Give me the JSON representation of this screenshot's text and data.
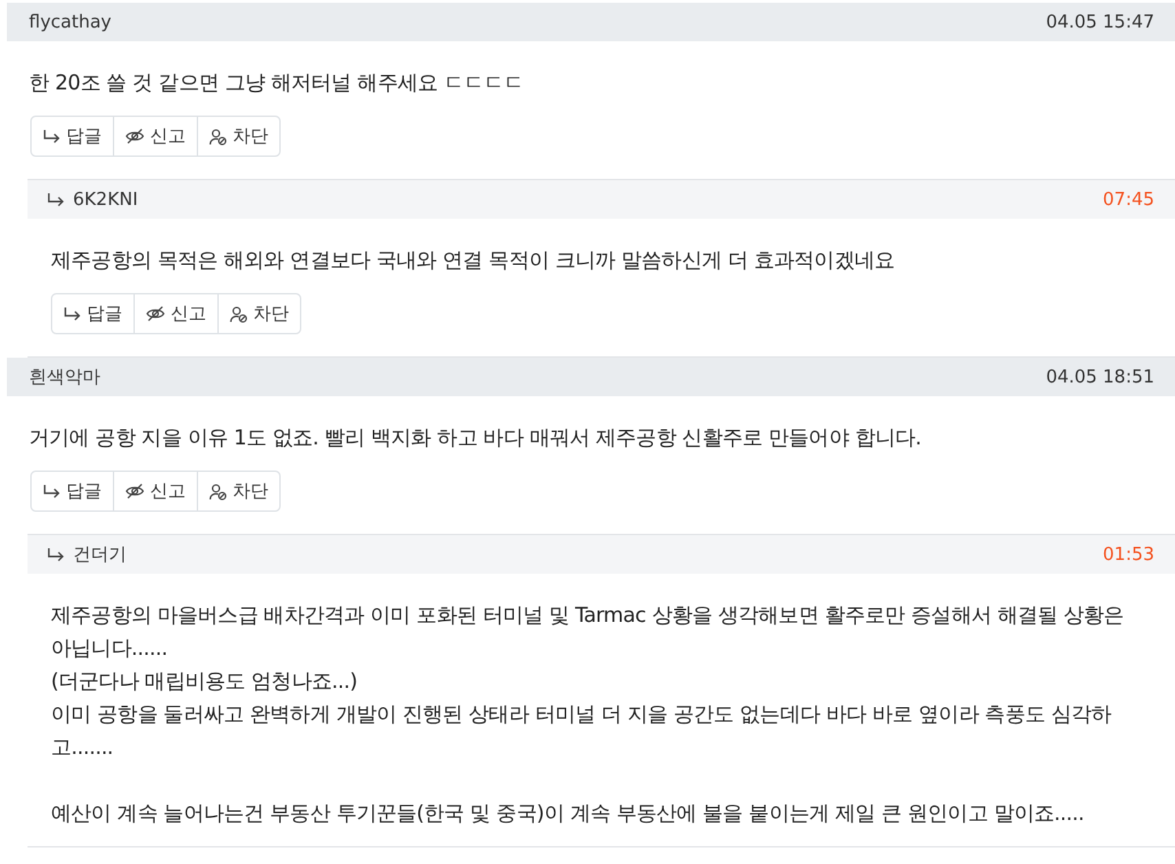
{
  "comments": [
    {
      "author": "flycathay",
      "time": "04.05 15:47",
      "time_highlighted": false,
      "body": [
        [
          "한 20조 쓸 것 같으면 그냥 해저터널 해주세요 ㄷㄷㄷㄷ"
        ]
      ],
      "actions": [
        {
          "kind": "reply",
          "label": "답글"
        },
        {
          "kind": "report",
          "label": "신고"
        },
        {
          "kind": "block",
          "label": "차단"
        }
      ],
      "replies": [
        {
          "author": "6K2KNI",
          "time": "07:45",
          "time_highlighted": true,
          "body": [
            [
              "제주공항의 목적은 해외와 연결보다 국내와 연결 목적이 크니까 말씀하신게 더 효과적이겠네요"
            ]
          ],
          "actions": [
            {
              "kind": "reply",
              "label": "답글"
            },
            {
              "kind": "report",
              "label": "신고"
            },
            {
              "kind": "block",
              "label": "차단"
            }
          ]
        }
      ]
    },
    {
      "author": "흰색악마",
      "time": "04.05 18:51",
      "time_highlighted": false,
      "body": [
        [
          "거기에 공항 지을 이유 1도 없죠. 빨리 백지화 하고 바다 매꿔서 제주공항 신활주로 만들어야 합니다."
        ]
      ],
      "actions": [
        {
          "kind": "reply",
          "label": "답글"
        },
        {
          "kind": "report",
          "label": "신고"
        },
        {
          "kind": "block",
          "label": "차단"
        }
      ],
      "replies": [
        {
          "author": "건더기",
          "time": "01:53",
          "time_highlighted": true,
          "body": [
            [
              "제주공항의 마을버스급 배차간격과 이미 포화된 터미널 및 Tarmac 상황을 생각해보면 활주로만 증설해서 해결될 상황은 아닙니다......",
              "(더군다나 매립비용도 엄청나죠...)",
              "이미 공항을 둘러싸고 완벽하게 개발이 진행된 상태라 터미널 더 지을 공간도 없는데다 바다 바로 옆이라 측풍도 심각하고......."
            ],
            [
              "예산이 계속 늘어나는건 부동산 투기꾼들(한국 및 중국)이 계속 부동산에 불을 붙이는게 제일 큰 원인이고 말이죠....."
            ]
          ]
        }
      ]
    }
  ]
}
